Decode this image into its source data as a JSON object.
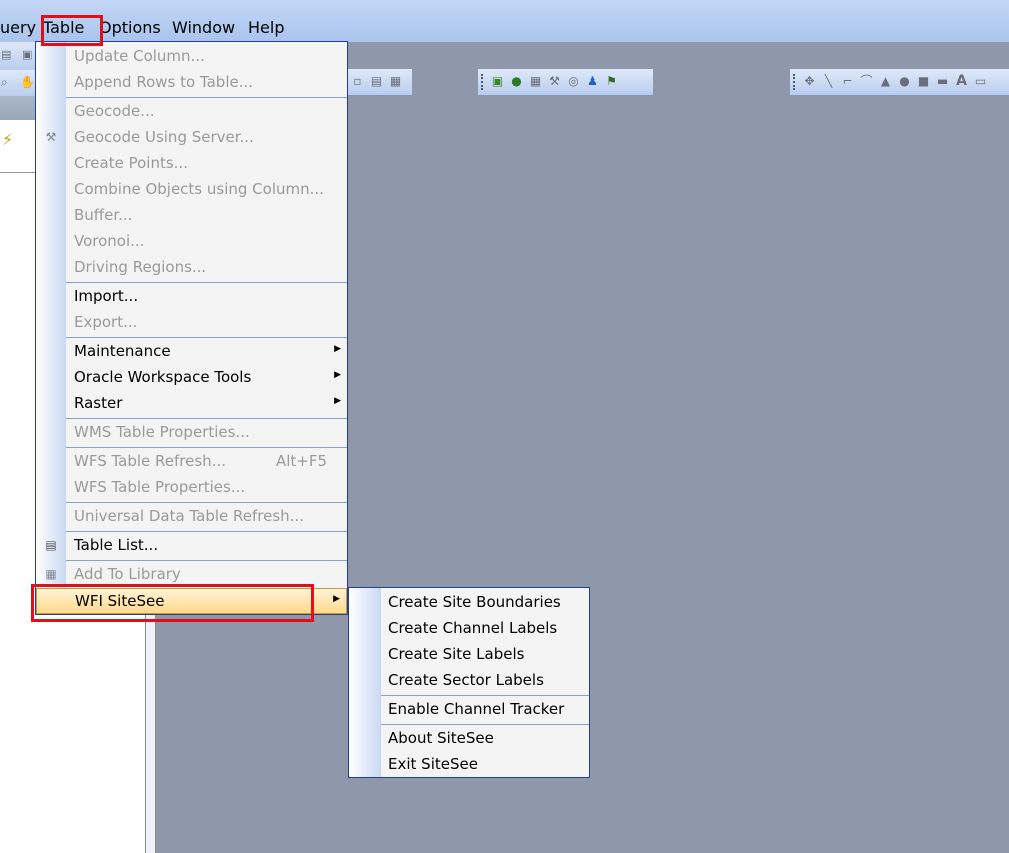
{
  "menubar": {
    "items": [
      {
        "label": "uery"
      },
      {
        "label": "Table"
      },
      {
        "label": "Options"
      },
      {
        "label": "Window"
      },
      {
        "label": "Help"
      }
    ]
  },
  "table_menu": {
    "items": [
      {
        "label": "Update Column...",
        "disabled": true
      },
      {
        "label": "Append Rows to Table...",
        "disabled": true
      },
      {
        "label": "Geocode...",
        "disabled": true
      },
      {
        "label": "Geocode Using Server...",
        "disabled": true,
        "icon": "geocode-server-icon"
      },
      {
        "label": "Create Points...",
        "disabled": true
      },
      {
        "label": "Combine Objects using Column...",
        "disabled": true
      },
      {
        "label": "Buffer...",
        "disabled": true
      },
      {
        "label": "Voronoi...",
        "disabled": true
      },
      {
        "label": "Driving Regions...",
        "disabled": true
      },
      {
        "label": "Import...",
        "disabled": false
      },
      {
        "label": "Export...",
        "disabled": true
      },
      {
        "label": "Maintenance",
        "disabled": false,
        "submenu": true
      },
      {
        "label": "Oracle Workspace Tools",
        "disabled": false,
        "submenu": true
      },
      {
        "label": "Raster",
        "disabled": false,
        "submenu": true
      },
      {
        "label": "WMS Table Properties...",
        "disabled": true
      },
      {
        "label": "WFS Table Refresh...",
        "disabled": true,
        "shortcut": "Alt+F5"
      },
      {
        "label": "WFS Table Properties...",
        "disabled": true
      },
      {
        "label": "Universal Data Table Refresh...",
        "disabled": true
      },
      {
        "label": "Table List...",
        "disabled": false,
        "icon": "table-list-icon"
      },
      {
        "label": "Add To Library",
        "disabled": true,
        "icon": "library-icon"
      },
      {
        "label": "WFI SiteSee",
        "disabled": false,
        "submenu": true,
        "active": true
      }
    ]
  },
  "sitesee_menu": {
    "items": [
      {
        "label": "Create Site Boundaries"
      },
      {
        "label": "Create Channel Labels"
      },
      {
        "label": "Create Site Labels"
      },
      {
        "label": "Create Sector Labels"
      },
      {
        "label": "Enable Channel Tracker"
      },
      {
        "label": "About SiteSee"
      },
      {
        "label": "Exit SiteSee"
      }
    ]
  },
  "colors": {
    "highlight_border": "#e0101a",
    "active_item": "#ffd98a",
    "workspace": "#8f98aa",
    "menu_border": "#203f96"
  }
}
